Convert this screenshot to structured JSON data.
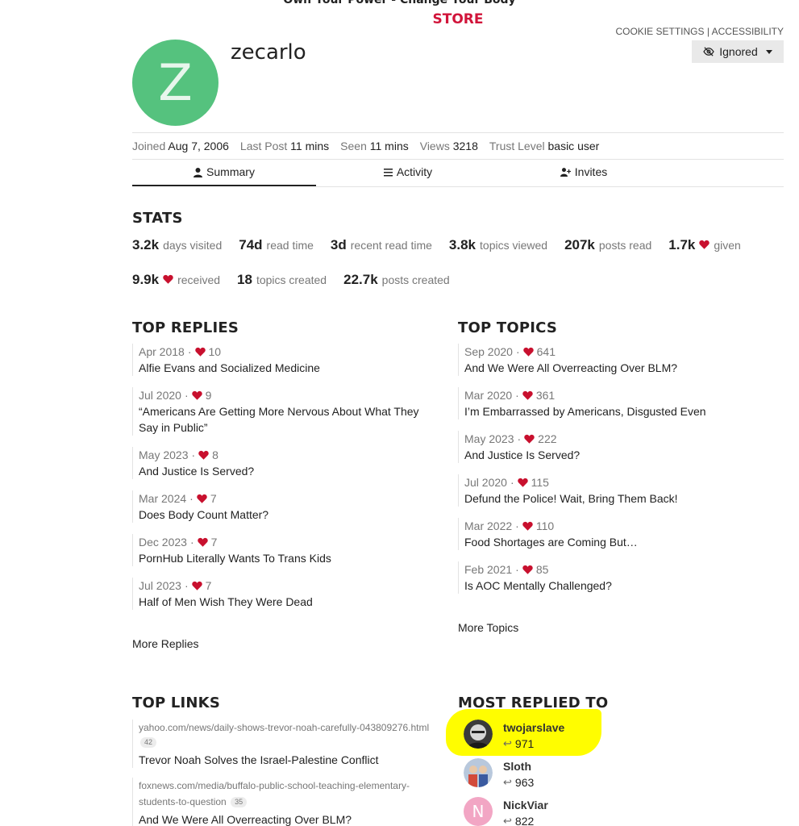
{
  "header": {
    "banner": "Own Your Power - Change Your Body",
    "store": "STORE",
    "cookie_settings": "COOKIE SETTINGS",
    "separator": "|",
    "accessibility": "ACCESSIBILITY"
  },
  "profile": {
    "avatar_letter": "Z",
    "avatar_color": "#55c27e",
    "username": "zecarlo",
    "ignored_label": "Ignored",
    "meta": {
      "joined_label": "Joined",
      "joined": "Aug 7, 2006",
      "last_post_label": "Last Post",
      "last_post": "11 mins",
      "seen_label": "Seen",
      "seen": "11 mins",
      "views_label": "Views",
      "views": "3218",
      "trust_label": "Trust Level",
      "trust": "basic user"
    }
  },
  "tabs": [
    {
      "label": "Summary",
      "icon": "user-icon"
    },
    {
      "label": "Activity",
      "icon": "list-icon"
    },
    {
      "label": "Invites",
      "icon": "user-plus-icon"
    }
  ],
  "stats": {
    "title": "STATS",
    "row1": [
      {
        "num": "3.2k",
        "label": "days visited"
      },
      {
        "num": "74d",
        "label": "read time"
      },
      {
        "num": "3d",
        "label": "recent read time"
      },
      {
        "num": "3.8k",
        "label": "topics viewed"
      },
      {
        "num": "207k",
        "label": "posts read"
      },
      {
        "num": "1.7k",
        "label": "given"
      }
    ],
    "row2": [
      {
        "num": "9.9k",
        "label": "received"
      },
      {
        "num": "18",
        "label": "topics created"
      },
      {
        "num": "22.7k",
        "label": "posts created"
      }
    ]
  },
  "top_replies": {
    "title": "TOP REPLIES",
    "more": "More Replies",
    "items": [
      {
        "date": "Apr 2018",
        "likes": "10",
        "title": "Alfie Evans and Socialized Medicine"
      },
      {
        "date": "Jul 2020",
        "likes": "9",
        "title": "“Americans Are Getting More Nervous About What They Say in Public”"
      },
      {
        "date": "May 2023",
        "likes": "8",
        "title": "And Justice Is Served?"
      },
      {
        "date": "Mar 2024",
        "likes": "7",
        "title": "Does Body Count Matter?"
      },
      {
        "date": "Dec 2023",
        "likes": "7",
        "title": "PornHub Literally Wants To Trans Kids"
      },
      {
        "date": "Jul 2023",
        "likes": "7",
        "title": "Half of Men Wish They Were Dead"
      }
    ]
  },
  "top_topics": {
    "title": "TOP TOPICS",
    "more": "More Topics",
    "items": [
      {
        "date": "Sep 2020",
        "likes": "641",
        "title": "And We Were All Overreacting Over BLM?"
      },
      {
        "date": "Mar 2020",
        "likes": "361",
        "title": "I’m Embarrassed by Americans, Disgusted Even"
      },
      {
        "date": "May 2023",
        "likes": "222",
        "title": "And Justice Is Served?"
      },
      {
        "date": "Jul 2020",
        "likes": "115",
        "title": "Defund the Police! Wait, Bring Them Back!"
      },
      {
        "date": "Mar 2022",
        "likes": "110",
        "title": "Food Shortages are Coming But…"
      },
      {
        "date": "Feb 2021",
        "likes": "85",
        "title": "Is AOC Mentally Challenged?"
      }
    ]
  },
  "top_links": {
    "title": "TOP LINKS",
    "items": [
      {
        "url": "yahoo.com/news/daily-shows-trevor-noah-carefully-043809276.html",
        "clicks": "42",
        "title": "Trevor Noah Solves the Israel-Palestine Conflict"
      },
      {
        "url": "foxnews.com/media/buffalo-public-school-teaching-elementary-students-to-question",
        "clicks": "35",
        "title": "And We Were All Overreacting Over BLM?"
      }
    ]
  },
  "most_replied": {
    "title": "MOST REPLIED TO",
    "users": [
      {
        "name": "twojarslave",
        "count": "971"
      },
      {
        "name": "Sloth",
        "count": "963"
      },
      {
        "name": "NickViar",
        "count": "822",
        "letter": "N"
      }
    ]
  },
  "colors": {
    "accent_red": "#d1143a",
    "heart": "#c8102e",
    "highlight": "#fffd00"
  }
}
